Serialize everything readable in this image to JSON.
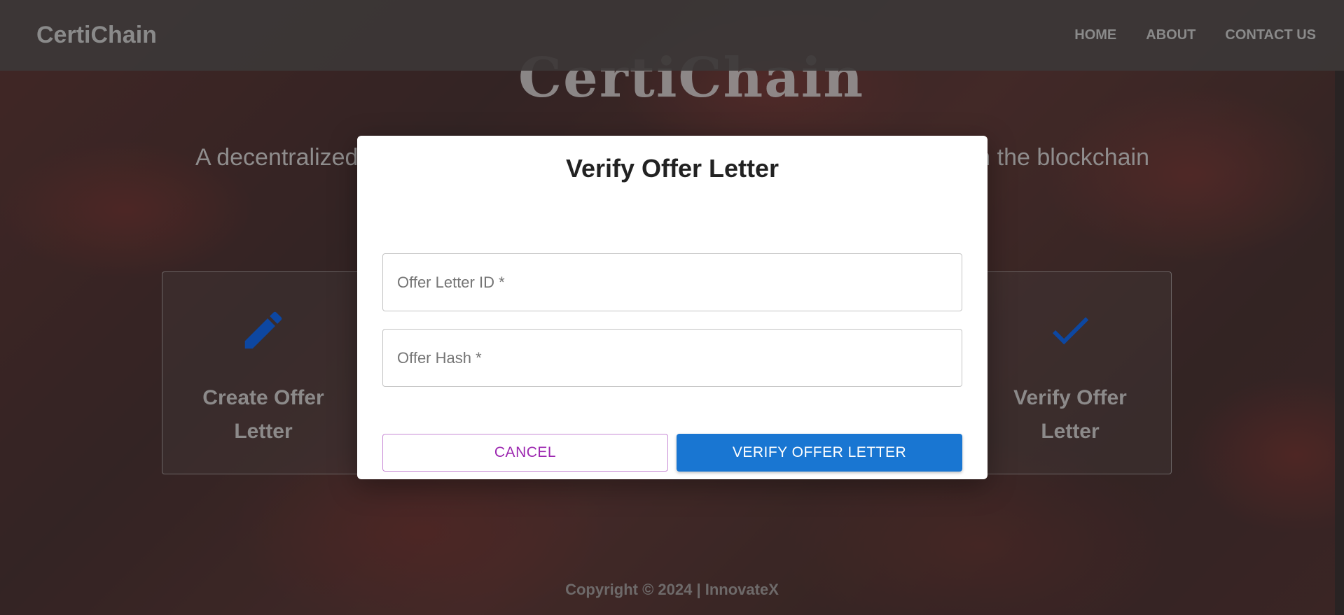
{
  "navbar": {
    "brand": "CertiChain",
    "links": [
      "HOME",
      "ABOUT",
      "CONTACT US"
    ]
  },
  "hero": {
    "logo_text": "CertiChain",
    "description": "A decentralized platform to securely generate and store your offer letters on the blockchain"
  },
  "cards": [
    {
      "title": "Create Offer Letter",
      "icon": "pencil-icon"
    },
    {
      "title": "Verify Offer Letter",
      "icon": "checkmark-icon"
    }
  ],
  "footer": {
    "copyright": "Copyright © 2024 | InnovateX"
  },
  "modal": {
    "title": "Verify Offer Letter",
    "offer_id_placeholder": "Offer Letter ID *",
    "offer_hash_placeholder": "Offer Hash *",
    "cancel_label": "CANCEL",
    "verify_label": "VERIFY OFFER LETTER"
  },
  "colors": {
    "primary": "#1976d2",
    "cancel_text": "#9c27b0",
    "icon_blue": "#0d47a1"
  }
}
